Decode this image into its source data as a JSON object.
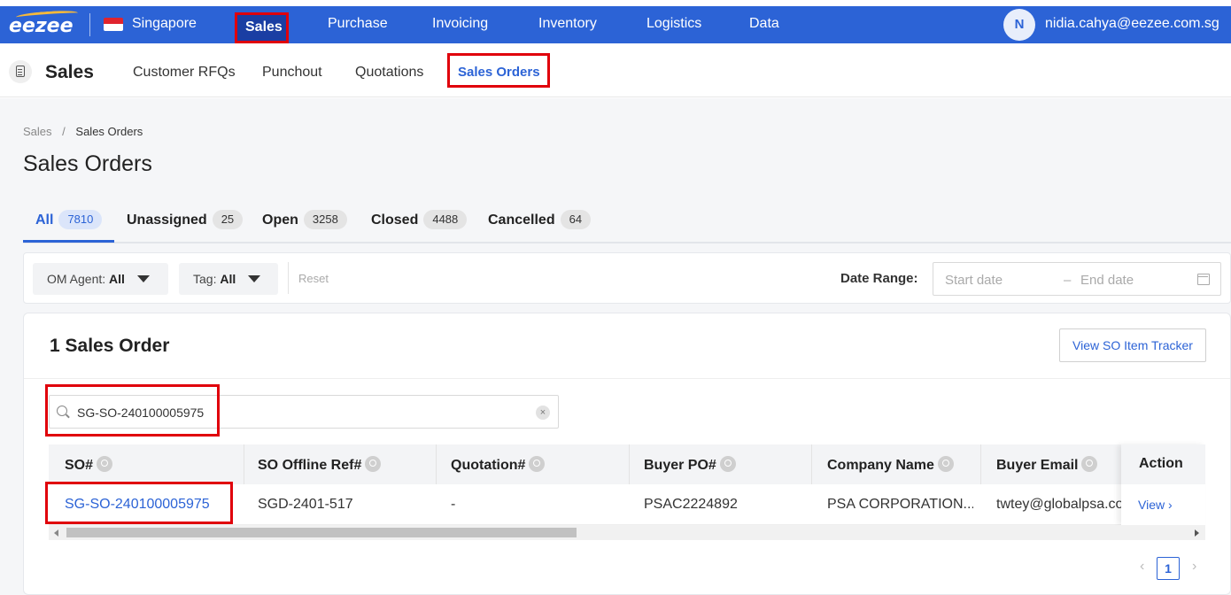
{
  "topnav": {
    "logo": "eezee",
    "country": "Singapore",
    "items": [
      "Sales",
      "Purchase",
      "Invoicing",
      "Inventory",
      "Logistics",
      "Data"
    ],
    "avatar_initial": "N",
    "user_email": "nidia.cahya@eezee.com.sg",
    "brand_color": "#2c63d6",
    "highlight_color": "#e0000b"
  },
  "subnav": {
    "title": "Sales",
    "links": [
      "Customer RFQs",
      "Punchout",
      "Quotations",
      "Sales Orders"
    ],
    "active": "Sales Orders"
  },
  "breadcrumb": {
    "root": "Sales",
    "separator": "/",
    "current": "Sales Orders"
  },
  "page_title": "Sales Orders",
  "tabs": [
    {
      "label": "All",
      "count": "7810"
    },
    {
      "label": "Unassigned",
      "count": "25"
    },
    {
      "label": "Open",
      "count": "3258"
    },
    {
      "label": "Closed",
      "count": "4488"
    },
    {
      "label": "Cancelled",
      "count": "64"
    }
  ],
  "filters": {
    "om_agent_label": "OM Agent:",
    "om_agent_value": "All",
    "tag_label": "Tag:",
    "tag_value": "All",
    "reset": "Reset",
    "date_range_label": "Date Range:",
    "start_placeholder": "Start date",
    "end_placeholder": "End date",
    "date_separator": "–"
  },
  "panel": {
    "title": "1 Sales Order",
    "tracker_button": "View SO Item Tracker"
  },
  "search": {
    "value": "SG-SO-240100005975",
    "clear": "×"
  },
  "table": {
    "columns": [
      "SO#",
      "SO Offline Ref#",
      "Quotation#",
      "Buyer PO#",
      "Company Name",
      "Buyer Email",
      "Action"
    ],
    "rows": [
      {
        "so": "SG-SO-240100005975",
        "offline_ref": "SGD-2401-517",
        "quotation": "-",
        "buyer_po": "PSAC2224892",
        "company": "PSA CORPORATION...",
        "buyer_email": "twtey@globalpsa.com",
        "action": "View ›"
      }
    ]
  },
  "pagination": {
    "prev": "‹",
    "current": "1",
    "next": "›"
  }
}
